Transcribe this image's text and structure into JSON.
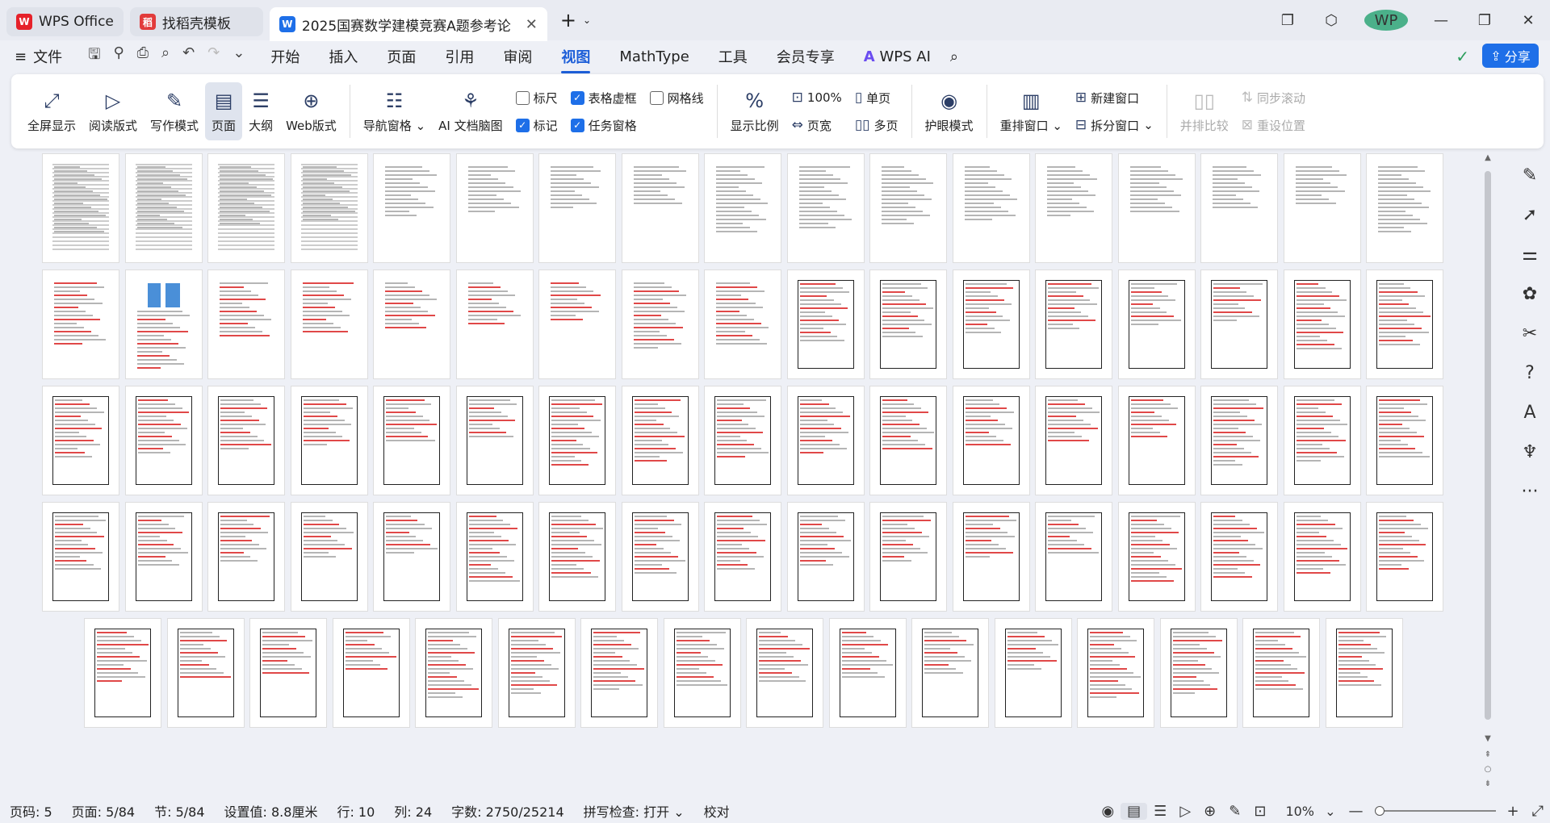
{
  "tabs": [
    {
      "label": "WPS Office",
      "logo": "W",
      "color": "#e6212a"
    },
    {
      "label": "找稻壳模板",
      "logo": "稻",
      "color": "#e23b3b"
    },
    {
      "label": "2025国赛数学建模竞赛A题参考论",
      "logo": "W",
      "color": "#1e6fe8"
    }
  ],
  "menu": {
    "file": "文件",
    "items": [
      "开始",
      "插入",
      "页面",
      "引用",
      "审阅",
      "视图",
      "MathType",
      "工具",
      "会员专享",
      "WPS AI"
    ],
    "active": "视图",
    "share": "分享"
  },
  "ribbon": {
    "views": [
      "全屏显示",
      "阅读版式",
      "写作模式",
      "页面",
      "大纲",
      "Web版式"
    ],
    "nav": "导航窗格",
    "ai_map": "AI 文档脑图",
    "checks": [
      {
        "label": "标尺",
        "on": false
      },
      {
        "label": "表格虚框",
        "on": true
      },
      {
        "label": "网格线",
        "on": false
      },
      {
        "label": "标记",
        "on": true
      },
      {
        "label": "任务窗格",
        "on": true
      }
    ],
    "zoom": "显示比例",
    "zoom100": "100%",
    "pagewidth": "页宽",
    "single": "单页",
    "multi": "多页",
    "eye": "护眼模式",
    "rearrange": "重排窗口",
    "newwin": "新建窗口",
    "split": "拆分窗口",
    "sidebyside": "并排比较",
    "syncscroll": "同步滚动",
    "resetpos": "重设位置"
  },
  "status": {
    "pagecode": "页码: 5",
    "page": "页面: 5/84",
    "section": "节: 5/84",
    "setting": "设置值: 8.8厘米",
    "row": "行: 10",
    "col": "列: 24",
    "words": "字数: 2750/25214",
    "spell": "拼写检查: 打开",
    "proof": "校对",
    "zoom": "10%"
  }
}
